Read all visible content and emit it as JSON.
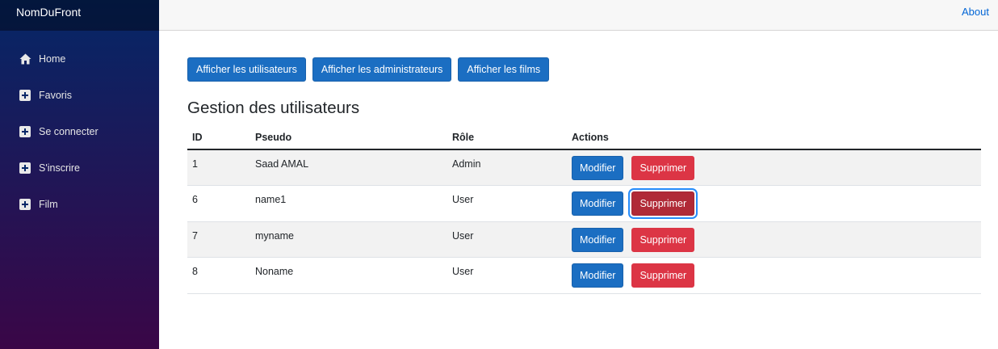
{
  "sidebar": {
    "brand": "NomDuFront",
    "items": [
      {
        "label": "Home",
        "icon": "home-icon"
      },
      {
        "label": "Favoris",
        "icon": "plus-icon"
      },
      {
        "label": "Se connecter",
        "icon": "plus-icon"
      },
      {
        "label": "S'inscrire",
        "icon": "plus-icon"
      },
      {
        "label": "Film",
        "icon": "plus-icon"
      }
    ]
  },
  "topbar": {
    "about": "About"
  },
  "buttons": {
    "users": "Afficher les utilisateurs",
    "admins": "Afficher les administrateurs",
    "films": "Afficher les films"
  },
  "page": {
    "title": "Gestion des utilisateurs"
  },
  "table": {
    "headers": [
      "ID",
      "Pseudo",
      "Rôle",
      "Actions"
    ],
    "rows": [
      {
        "id": "1",
        "pseudo": "Saad AMAL",
        "role": "Admin",
        "edit": "Modifier",
        "delete": "Supprimer"
      },
      {
        "id": "6",
        "pseudo": "name1",
        "role": "User",
        "edit": "Modifier",
        "delete": "Supprimer"
      },
      {
        "id": "7",
        "pseudo": "myname",
        "role": "User",
        "edit": "Modifier",
        "delete": "Supprimer"
      },
      {
        "id": "8",
        "pseudo": "Noname",
        "role": "User",
        "edit": "Modifier",
        "delete": "Supprimer"
      }
    ]
  },
  "colors": {
    "primary": "#1b6ec2",
    "danger": "#dc3545",
    "sidebar_top": "#052767",
    "sidebar_bottom": "#3a0647"
  }
}
